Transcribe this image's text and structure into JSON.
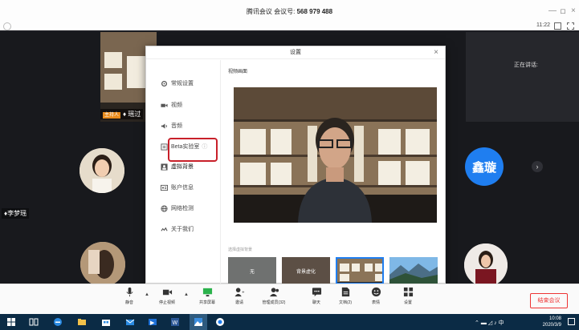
{
  "window": {
    "title_prefix": "腾讯会议 会议号:",
    "meeting_id": "568 979 488",
    "minimize": "—",
    "restore": "ロ",
    "close": "×"
  },
  "subbar": {
    "time": "11:22"
  },
  "stage": {
    "speaking_label": "正在讲话:",
    "host_tag": "主持人",
    "participant_top_name": "瑶过",
    "participant_left_name": "李梦瑶",
    "blue_avatar_text": "鑫璇",
    "next_arrow": "›"
  },
  "dialog": {
    "title": "设置",
    "close": "×",
    "nav": [
      {
        "label": "常规设置",
        "icon": "gear-icon"
      },
      {
        "label": "视频",
        "icon": "camera-icon"
      },
      {
        "label": "音频",
        "icon": "speaker-icon"
      },
      {
        "label": "Beta实验室",
        "icon": "lab-icon"
      },
      {
        "label": "虚拟背景",
        "icon": "background-icon"
      },
      {
        "label": "账户信息",
        "icon": "account-icon"
      },
      {
        "label": "网络检测",
        "icon": "network-icon"
      },
      {
        "label": "关于我们",
        "icon": "about-icon"
      }
    ],
    "preview_label": "视频画面",
    "bg_select_label": "选择虚拟背景",
    "thumbnails": [
      {
        "label": "无"
      },
      {
        "label": "背景虚化"
      },
      {
        "label": ""
      },
      {
        "label": ""
      }
    ]
  },
  "toolbar": {
    "items": [
      {
        "label": "静音",
        "icon": "microphone-icon"
      },
      {
        "label": "停止视频",
        "icon": "video-camera-icon"
      },
      {
        "label": "共享屏幕",
        "icon": "share-screen-icon"
      },
      {
        "label": "邀请",
        "icon": "invite-icon"
      },
      {
        "label": "管理成员(32)",
        "icon": "manage-members-icon"
      },
      {
        "label": "聊天",
        "icon": "chat-icon"
      },
      {
        "label": "文档(2)",
        "icon": "document-icon"
      },
      {
        "label": "表情",
        "icon": "emoji-icon"
      },
      {
        "label": "设置",
        "icon": "settings-icon"
      }
    ],
    "end_meeting": "结束会议"
  },
  "taskbar": {
    "ime": "中",
    "time": "10:08",
    "date": "2020/3/9"
  },
  "colors": {
    "accent_blue": "#1f7ef0",
    "highlight_red": "#c8202a",
    "end_red": "#ee3333",
    "taskbar": "#0b2b45",
    "host_orange": "#e88b1d"
  }
}
